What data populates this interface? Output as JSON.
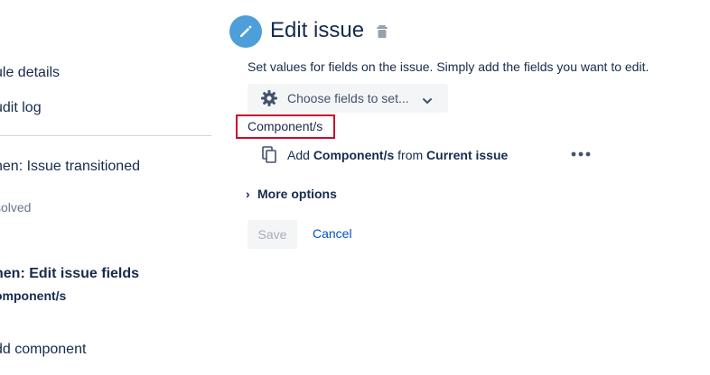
{
  "sidebar": {
    "items": [
      {
        "label": "ule details"
      },
      {
        "label": "udit log"
      }
    ],
    "trigger": {
      "label": "hen: Issue transitioned",
      "sub": "solved"
    },
    "action": {
      "label": "hen: Edit issue fields",
      "sub": "omponent/s"
    },
    "next_action": {
      "label": "dd component"
    }
  },
  "header": {
    "title": "Edit issue",
    "icon": "pencil-icon",
    "accent": "#4c9fd8"
  },
  "main": {
    "description": "Set values for fields on the issue. Simply add the fields you want to edit.",
    "choose_fields": {
      "label": "Choose fields to set..."
    },
    "field": {
      "label": "Component/s",
      "highlight_color": "#c8102e",
      "copy_prefix": "Add",
      "copy_field": "Component/s",
      "copy_from": "from",
      "copy_source": "Current issue"
    },
    "more_options": {
      "label": "More options"
    },
    "save_label": "Save",
    "cancel_label": "Cancel"
  }
}
